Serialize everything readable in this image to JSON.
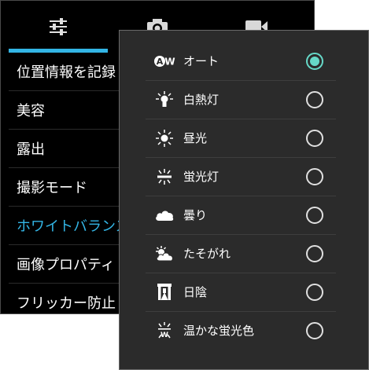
{
  "settings_tabs": [
    {
      "icon": "sliders-icon",
      "selected": true
    },
    {
      "icon": "camera-icon",
      "selected": false
    },
    {
      "icon": "video-camera-icon",
      "selected": false
    }
  ],
  "settings_list": [
    {
      "label": "位置情報を記録"
    },
    {
      "label": "美容"
    },
    {
      "label": "露出"
    },
    {
      "label": "撮影モード"
    },
    {
      "label": "ホワイトバランス",
      "active": true
    },
    {
      "label": "画像プロパティ"
    },
    {
      "label": "フリッカー防止"
    }
  ],
  "white_balance": {
    "auto_icon_text": "AW",
    "options": [
      {
        "label": "オート",
        "icon": "auto-wb-icon",
        "selected": true
      },
      {
        "label": "白熱灯",
        "icon": "incandescent-icon",
        "selected": false
      },
      {
        "label": "昼光",
        "icon": "daylight-sun-icon",
        "selected": false
      },
      {
        "label": "蛍光灯",
        "icon": "fluorescent-icon",
        "selected": false
      },
      {
        "label": "曇り",
        "icon": "cloudy-icon",
        "selected": false
      },
      {
        "label": "たそがれ",
        "icon": "twilight-icon",
        "selected": false
      },
      {
        "label": "日陰",
        "icon": "shade-icon",
        "selected": false
      },
      {
        "label": "温かな蛍光色",
        "icon": "warm-fluorescent-icon",
        "selected": false
      }
    ]
  },
  "colors": {
    "accent": "#33b5e5",
    "radio_selected": "#66d9c8",
    "radio_ring": "#e0e0e0",
    "popup_bg": "#2b2b2b",
    "panel_bg": "#000000"
  }
}
